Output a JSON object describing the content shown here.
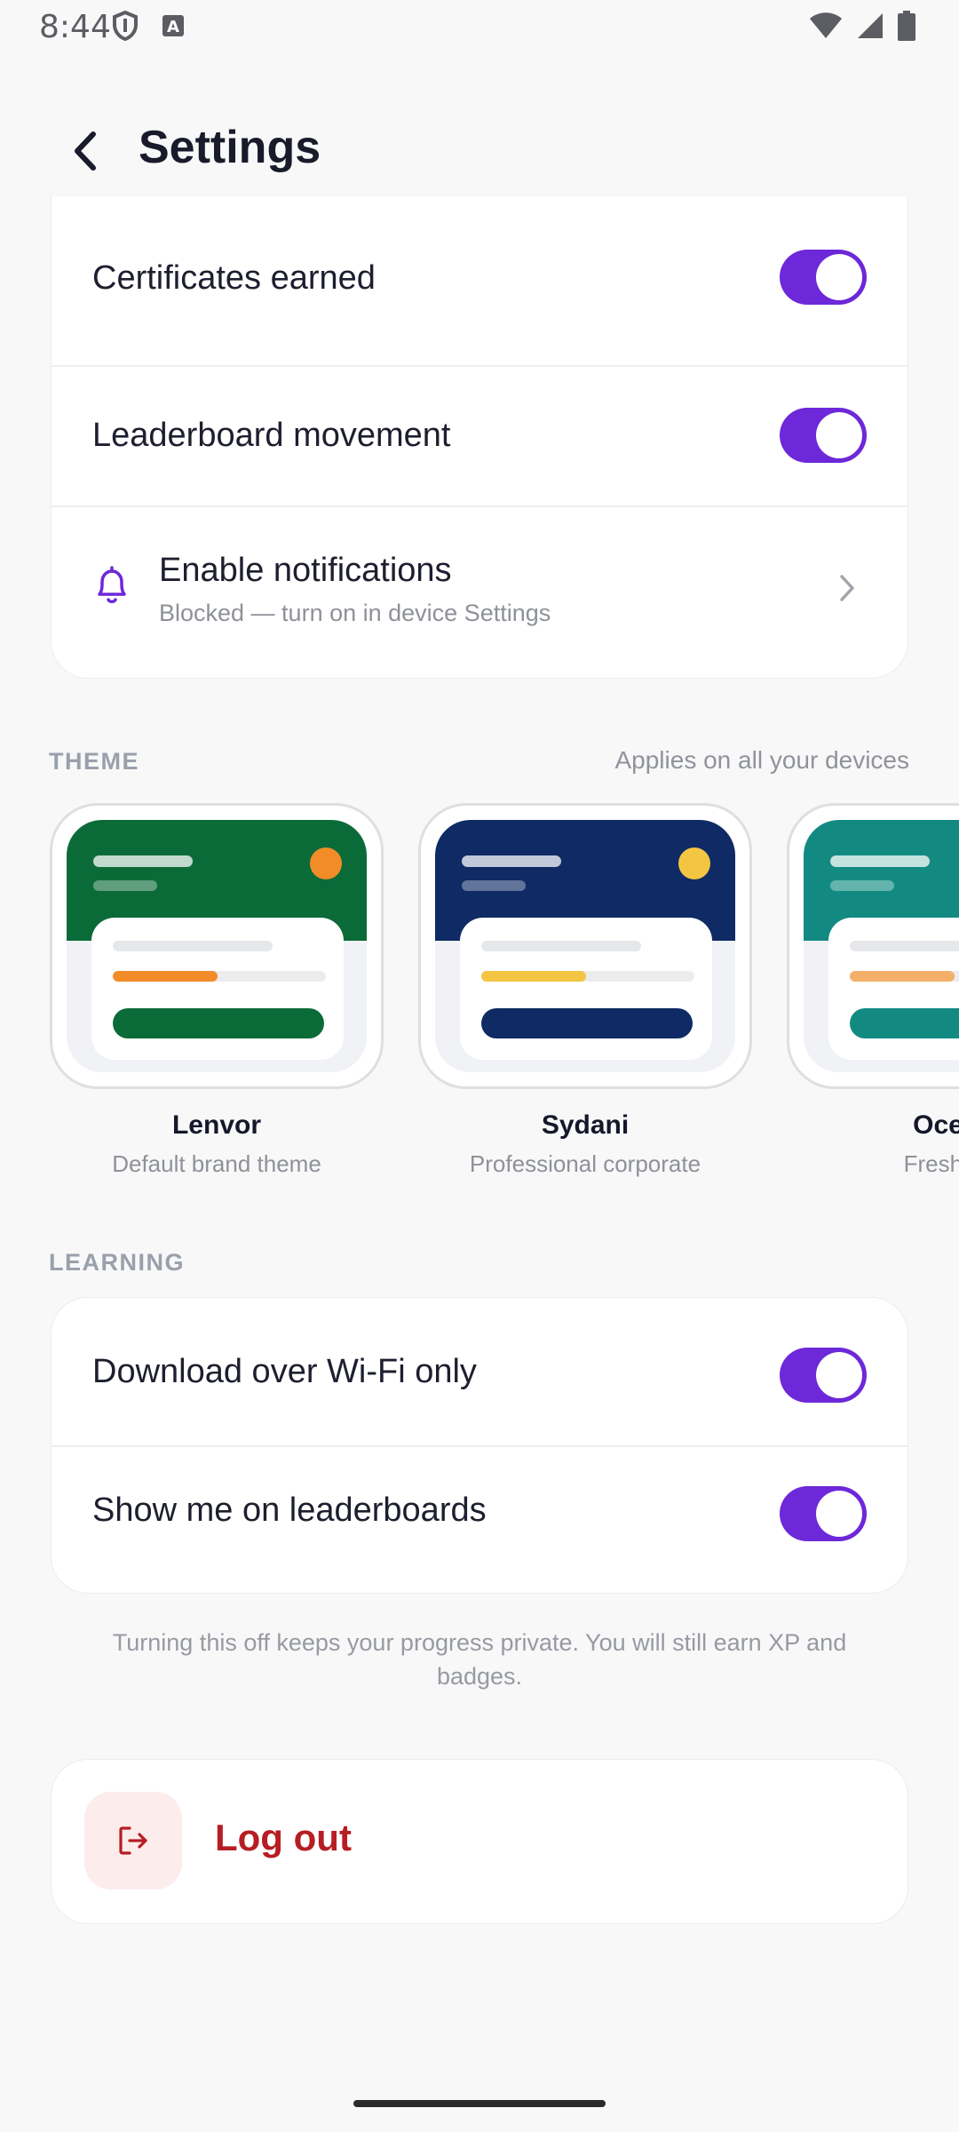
{
  "status_bar": {
    "time": "8:44",
    "icons_left": [
      "shield-icon",
      "a-badge-icon"
    ],
    "icons_right": [
      "wifi-icon",
      "signal-icon",
      "battery-icon"
    ]
  },
  "header": {
    "title": "Settings"
  },
  "notifications": {
    "rows": [
      {
        "label": "Certificates earned",
        "enabled": true
      },
      {
        "label": "Leaderboard movement",
        "enabled": true
      }
    ],
    "enable_row": {
      "label": "Enable notifications",
      "sublabel": "Blocked — turn on in device Settings"
    }
  },
  "theme": {
    "section_label": "THEME",
    "note": "Applies on all your devices",
    "options": [
      {
        "name": "Lenvor",
        "description": "Default brand theme",
        "primary": "#0b6b38",
        "accent": "#f28c28"
      },
      {
        "name": "Sydani",
        "description": "Professional corporate",
        "primary": "#0f2a64",
        "accent": "#f4c542"
      },
      {
        "name": "Ocean",
        "description": "Fresh & n",
        "primary": "#128a82",
        "accent": "#f4b06a"
      }
    ]
  },
  "learning": {
    "section_label": "LEARNING",
    "rows": [
      {
        "label": "Download over Wi-Fi only",
        "enabled": true
      },
      {
        "label": "Show me on leaderboards",
        "enabled": true
      }
    ],
    "footnote": "Turning this off keeps your progress private. You will still earn XP and badges."
  },
  "logout": {
    "label": "Log out"
  },
  "colors": {
    "accent": "#6d28d9",
    "danger": "#b61e23"
  }
}
